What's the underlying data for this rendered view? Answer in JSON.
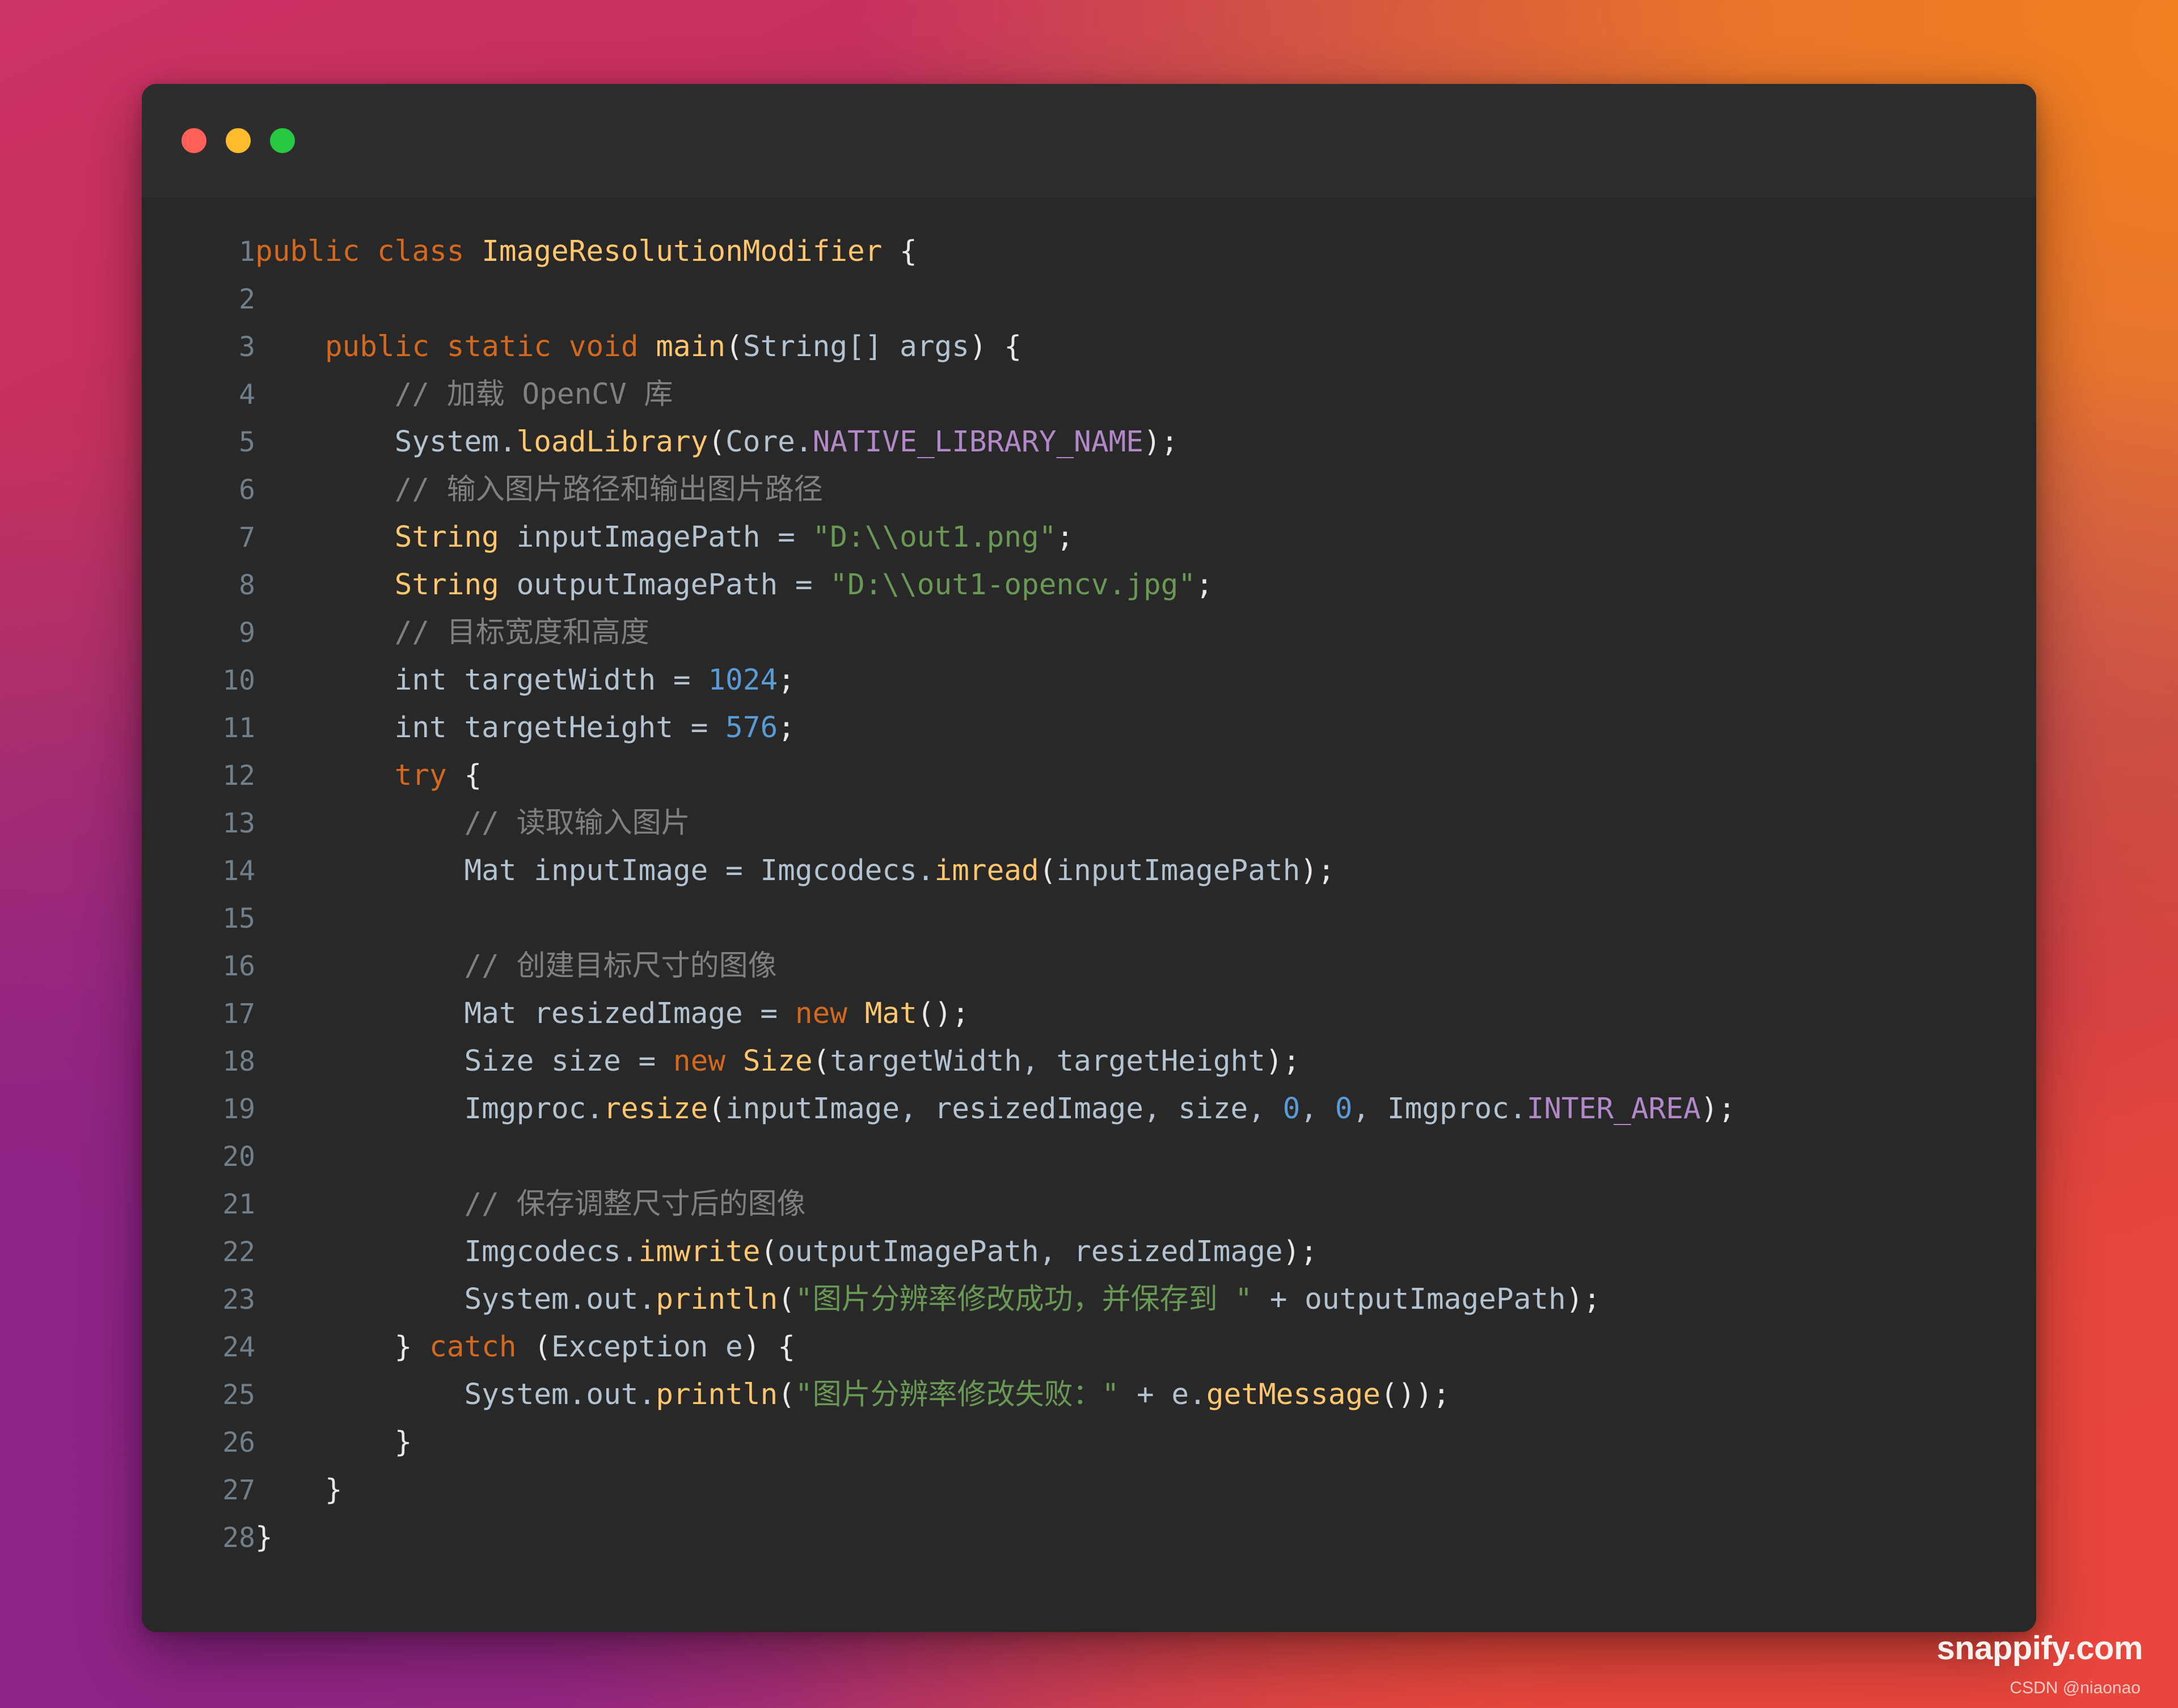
{
  "window": {
    "controls": [
      {
        "name": "close",
        "color": "#FF5F57"
      },
      {
        "name": "minimize",
        "color": "#FFBD2E"
      },
      {
        "name": "maximize",
        "color": "#28C840"
      }
    ]
  },
  "theme": {
    "editor_background": "#282828",
    "titlebar_background": "#2d2d2d",
    "line_number_color": "#6f7f8c",
    "keyword_color": "#d2691e",
    "type_color": "#ffc66d",
    "function_color": "#ffc66d",
    "string_color": "#6a9955",
    "number_color": "#5b9bd5",
    "comment_color": "#808080",
    "constant_color": "#b388c9",
    "plain_color": "#b3c3d1",
    "gradient_top_left": "#CC3365",
    "gradient_top_right": "#F4811F",
    "gradient_bottom_left": "#8E2388",
    "gradient_bottom_right": "#E8453C"
  },
  "watermarks": {
    "brand": "snappify.com",
    "credit": "CSDN @niaonao"
  },
  "code": {
    "language": "java",
    "class_name": "ImageResolutionModifier",
    "lines": [
      {
        "n": "1",
        "tokens": [
          {
            "t": "kw",
            "v": "public"
          },
          {
            "t": "pl",
            "v": " "
          },
          {
            "t": "kw",
            "v": "class"
          },
          {
            "t": "pl",
            "v": " "
          },
          {
            "t": "type",
            "v": "ImageResolutionModifier"
          },
          {
            "t": "pun",
            "v": " {"
          }
        ]
      },
      {
        "n": "2",
        "tokens": []
      },
      {
        "n": "3",
        "tokens": [
          {
            "t": "pl",
            "v": "    "
          },
          {
            "t": "kw",
            "v": "public"
          },
          {
            "t": "pl",
            "v": " "
          },
          {
            "t": "kw",
            "v": "static"
          },
          {
            "t": "pl",
            "v": " "
          },
          {
            "t": "kw",
            "v": "void"
          },
          {
            "t": "pl",
            "v": " "
          },
          {
            "t": "fn",
            "v": "main"
          },
          {
            "t": "pun",
            "v": "("
          },
          {
            "t": "pl",
            "v": "String[] args"
          },
          {
            "t": "pun",
            "v": ") {"
          }
        ]
      },
      {
        "n": "4",
        "tokens": [
          {
            "t": "pl",
            "v": "        "
          },
          {
            "t": "cmt",
            "v": "// 加载 OpenCV 库"
          }
        ]
      },
      {
        "n": "5",
        "tokens": [
          {
            "t": "pl",
            "v": "        System."
          },
          {
            "t": "fn",
            "v": "loadLibrary"
          },
          {
            "t": "pun",
            "v": "("
          },
          {
            "t": "pl",
            "v": "Core."
          },
          {
            "t": "const",
            "v": "NATIVE_LIBRARY_NAME"
          },
          {
            "t": "pun",
            "v": ");"
          }
        ]
      },
      {
        "n": "6",
        "tokens": [
          {
            "t": "pl",
            "v": "        "
          },
          {
            "t": "cmt",
            "v": "// 输入图片路径和输出图片路径"
          }
        ]
      },
      {
        "n": "7",
        "tokens": [
          {
            "t": "pl",
            "v": "        "
          },
          {
            "t": "type",
            "v": "String"
          },
          {
            "t": "pl",
            "v": " inputImagePath "
          },
          {
            "t": "pl",
            "v": "= "
          },
          {
            "t": "str",
            "v": "\"D:\\\\out1.png\""
          },
          {
            "t": "pun",
            "v": ";"
          }
        ]
      },
      {
        "n": "8",
        "tokens": [
          {
            "t": "pl",
            "v": "        "
          },
          {
            "t": "type",
            "v": "String"
          },
          {
            "t": "pl",
            "v": " outputImagePath "
          },
          {
            "t": "pl",
            "v": "= "
          },
          {
            "t": "str",
            "v": "\"D:\\\\out1-opencv.jpg\""
          },
          {
            "t": "pun",
            "v": ";"
          }
        ]
      },
      {
        "n": "9",
        "tokens": [
          {
            "t": "pl",
            "v": "        "
          },
          {
            "t": "cmt",
            "v": "// 目标宽度和高度"
          }
        ]
      },
      {
        "n": "10",
        "tokens": [
          {
            "t": "pl",
            "v": "        int targetWidth = "
          },
          {
            "t": "num",
            "v": "1024"
          },
          {
            "t": "pun",
            "v": ";"
          }
        ]
      },
      {
        "n": "11",
        "tokens": [
          {
            "t": "pl",
            "v": "        int targetHeight = "
          },
          {
            "t": "num",
            "v": "576"
          },
          {
            "t": "pun",
            "v": ";"
          }
        ]
      },
      {
        "n": "12",
        "tokens": [
          {
            "t": "pl",
            "v": "        "
          },
          {
            "t": "kw",
            "v": "try"
          },
          {
            "t": "pun",
            "v": " {"
          }
        ]
      },
      {
        "n": "13",
        "tokens": [
          {
            "t": "pl",
            "v": "            "
          },
          {
            "t": "cmt",
            "v": "// 读取输入图片"
          }
        ]
      },
      {
        "n": "14",
        "tokens": [
          {
            "t": "pl",
            "v": "            Mat inputImage = Imgcodecs."
          },
          {
            "t": "fn",
            "v": "imread"
          },
          {
            "t": "pun",
            "v": "("
          },
          {
            "t": "pl",
            "v": "inputImagePath"
          },
          {
            "t": "pun",
            "v": ");"
          }
        ]
      },
      {
        "n": "15",
        "tokens": []
      },
      {
        "n": "16",
        "tokens": [
          {
            "t": "pl",
            "v": "            "
          },
          {
            "t": "cmt",
            "v": "// 创建目标尺寸的图像"
          }
        ]
      },
      {
        "n": "17",
        "tokens": [
          {
            "t": "pl",
            "v": "            Mat resizedImage = "
          },
          {
            "t": "kw",
            "v": "new"
          },
          {
            "t": "pl",
            "v": " "
          },
          {
            "t": "type",
            "v": "Mat"
          },
          {
            "t": "pun",
            "v": "();"
          }
        ]
      },
      {
        "n": "18",
        "tokens": [
          {
            "t": "pl",
            "v": "            Size size = "
          },
          {
            "t": "kw",
            "v": "new"
          },
          {
            "t": "pl",
            "v": " "
          },
          {
            "t": "type",
            "v": "Size"
          },
          {
            "t": "pun",
            "v": "("
          },
          {
            "t": "pl",
            "v": "targetWidth, targetHeight"
          },
          {
            "t": "pun",
            "v": ");"
          }
        ]
      },
      {
        "n": "19",
        "tokens": [
          {
            "t": "pl",
            "v": "            Imgproc."
          },
          {
            "t": "fn",
            "v": "resize"
          },
          {
            "t": "pun",
            "v": "("
          },
          {
            "t": "pl",
            "v": "inputImage, resizedImage, size, "
          },
          {
            "t": "num",
            "v": "0"
          },
          {
            "t": "pl",
            "v": ", "
          },
          {
            "t": "num",
            "v": "0"
          },
          {
            "t": "pl",
            "v": ", Imgproc."
          },
          {
            "t": "const",
            "v": "INTER_AREA"
          },
          {
            "t": "pun",
            "v": ");"
          }
        ]
      },
      {
        "n": "20",
        "tokens": []
      },
      {
        "n": "21",
        "tokens": [
          {
            "t": "pl",
            "v": "            "
          },
          {
            "t": "cmt",
            "v": "// 保存调整尺寸后的图像"
          }
        ]
      },
      {
        "n": "22",
        "tokens": [
          {
            "t": "pl",
            "v": "            Imgcodecs."
          },
          {
            "t": "fn",
            "v": "imwrite"
          },
          {
            "t": "pun",
            "v": "("
          },
          {
            "t": "pl",
            "v": "outputImagePath, resizedImage"
          },
          {
            "t": "pun",
            "v": ");"
          }
        ]
      },
      {
        "n": "23",
        "tokens": [
          {
            "t": "pl",
            "v": "            System.out."
          },
          {
            "t": "fn",
            "v": "println"
          },
          {
            "t": "pun",
            "v": "("
          },
          {
            "t": "str",
            "v": "\"图片分辨率修改成功，并保存到 \""
          },
          {
            "t": "pl",
            "v": " + outputImagePath"
          },
          {
            "t": "pun",
            "v": ");"
          }
        ]
      },
      {
        "n": "24",
        "tokens": [
          {
            "t": "pun",
            "v": "        } "
          },
          {
            "t": "kw",
            "v": "catch"
          },
          {
            "t": "pl",
            "v": " "
          },
          {
            "t": "pun",
            "v": "("
          },
          {
            "t": "pl",
            "v": "Exception e"
          },
          {
            "t": "pun",
            "v": ") {"
          }
        ]
      },
      {
        "n": "25",
        "tokens": [
          {
            "t": "pl",
            "v": "            System.out."
          },
          {
            "t": "fn",
            "v": "println"
          },
          {
            "t": "pun",
            "v": "("
          },
          {
            "t": "str",
            "v": "\"图片分辨率修改失败：\""
          },
          {
            "t": "pl",
            "v": " + e."
          },
          {
            "t": "fn",
            "v": "getMessage"
          },
          {
            "t": "pun",
            "v": "());"
          }
        ]
      },
      {
        "n": "26",
        "tokens": [
          {
            "t": "pun",
            "v": "        }"
          }
        ]
      },
      {
        "n": "27",
        "tokens": [
          {
            "t": "pun",
            "v": "    }"
          }
        ]
      },
      {
        "n": "28",
        "tokens": [
          {
            "t": "pun",
            "v": "}"
          }
        ]
      }
    ]
  }
}
